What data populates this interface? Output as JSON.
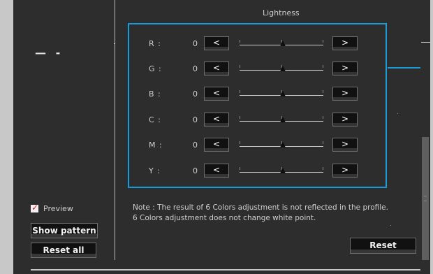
{
  "section_title": "Lightness",
  "left_dash": "— -",
  "rows": [
    {
      "label": "R :",
      "value": "0",
      "dec": "<",
      "inc": ">"
    },
    {
      "label": "G :",
      "value": "0",
      "dec": "<",
      "inc": ">"
    },
    {
      "label": "B :",
      "value": "0",
      "dec": "<",
      "inc": ">"
    },
    {
      "label": "C :",
      "value": "0",
      "dec": "<",
      "inc": ">"
    },
    {
      "label": "M :",
      "value": "0",
      "dec": "<",
      "inc": ">"
    },
    {
      "label": "Y :",
      "value": "0",
      "dec": "<",
      "inc": ">"
    }
  ],
  "preview": {
    "label": "Preview",
    "checked": true
  },
  "buttons": {
    "show_pattern": "Show pattern",
    "reset_all": "Reset all",
    "reset": "Reset"
  },
  "note_line1": "Note : The result of 6 Colors adjustment is not reflected in the profile.",
  "note_line2": "6 Colors adjustment does not change white point.",
  "colors": {
    "accent": "#1a9bd7",
    "check": "#d9201e",
    "bg": "#2d2d2d"
  }
}
